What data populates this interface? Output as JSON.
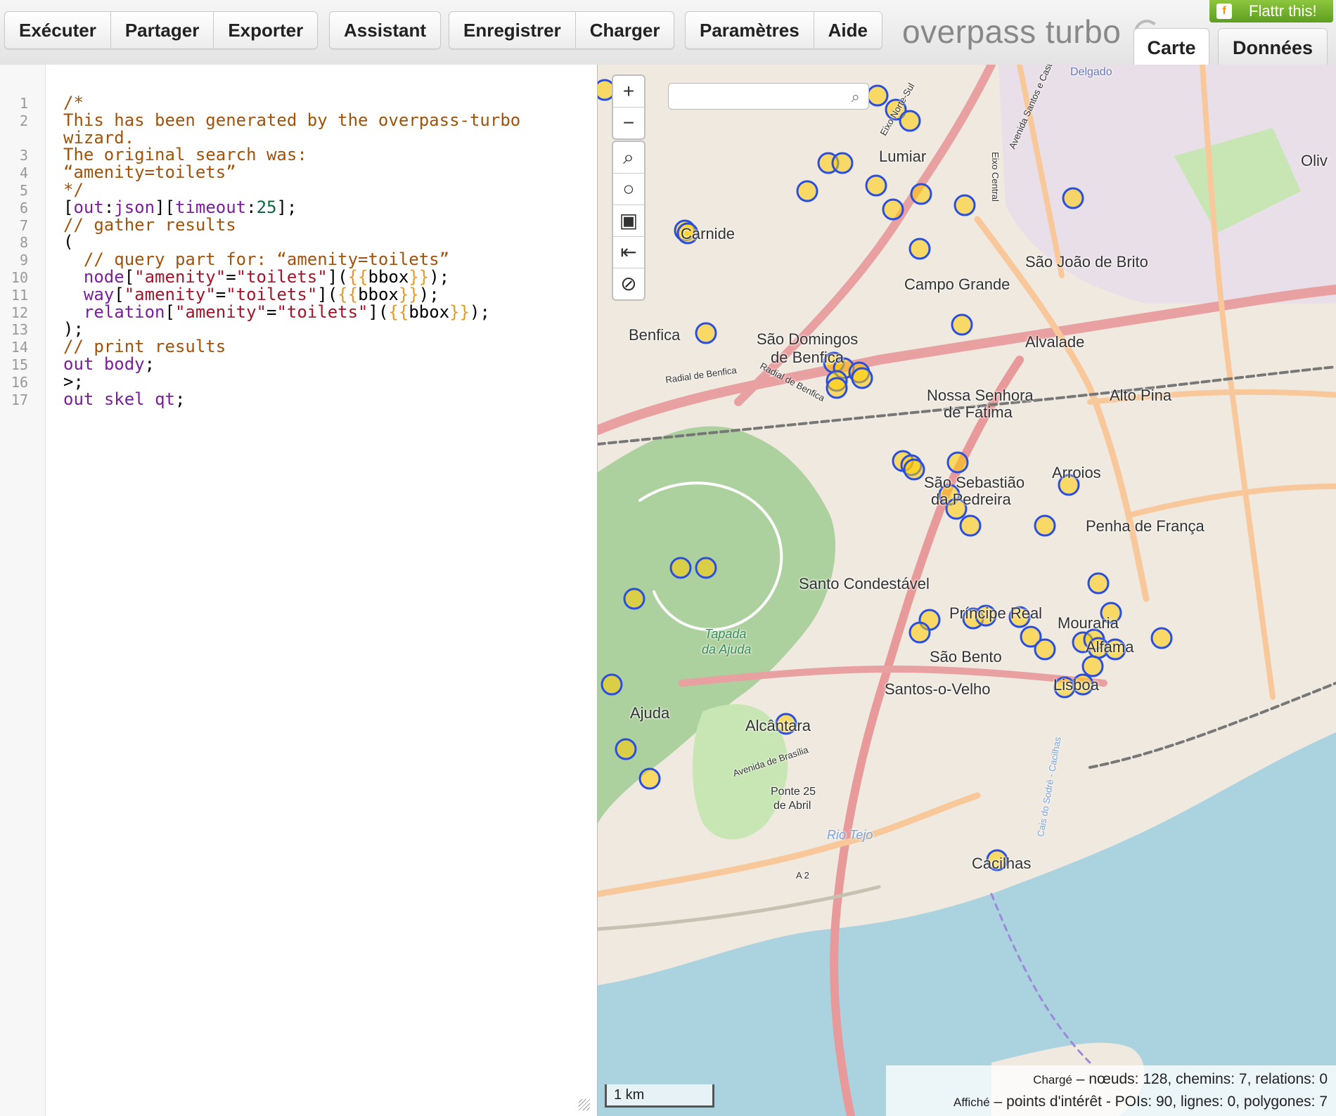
{
  "toolbar": {
    "group1": [
      "Exécuter",
      "Partager",
      "Exporter"
    ],
    "group2": [
      "Assistant"
    ],
    "group3": [
      "Enregistrer",
      "Charger"
    ],
    "group4": [
      "Paramètres",
      "Aide"
    ]
  },
  "brand": "overpass turbo",
  "flattr": "Flattr this!",
  "tabs": {
    "map": "Carte",
    "data": "Données"
  },
  "editor": {
    "lines": [
      "/*",
      "This has been generated by the overpass-turbo",
      "wizard.",
      "The original search was:",
      "“amenity=toilets”",
      "*/",
      "[out:json][timeout:25];",
      "// gather results",
      "(",
      "  // query part for: “amenity=toilets”",
      "  node[\"amenity\"=\"toilets\"]({{bbox}});",
      "  way[\"amenity\"=\"toilets\"]({{bbox}});",
      "  relation[\"amenity\"=\"toilets\"]({{bbox}});",
      ");",
      "// print results",
      "out body;",
      ">;",
      "out skel qt;"
    ],
    "line_numbers": [
      "1",
      "2",
      "",
      "3",
      "4",
      "5",
      "6",
      "7",
      "8",
      "9",
      "10",
      "11",
      "12",
      "13",
      "14",
      "15",
      "16",
      "17"
    ]
  },
  "map": {
    "zoom_in": "+",
    "zoom_out": "−",
    "scale": "1 km",
    "stats_loaded_label": "Chargé",
    "stats_loaded": "nœuds: 128, chemins: 7, relations: 0",
    "stats_shown_label": "Affiché",
    "stats_shown": "points d'intérêt - POIs: 90, lignes: 0, polygones: 7",
    "places": [
      "Lumiar",
      "Carnide",
      "Campo Grande",
      "São João de Brito",
      "Benfica",
      "São Domingos",
      "de Benfica",
      "Alvalade",
      "Nossa Senhora",
      "de Fátima",
      "Alto Pina",
      "Arroios",
      "São Sebastião",
      "da Pedreira",
      "Penha de França",
      "Santo Condestável",
      "Príncipe Real",
      "Mouraria",
      "Alfama",
      "São Bento",
      "Santos-o-Velho",
      "Lisboa",
      "Ajuda",
      "Alcântara",
      "Cacilhas",
      "Ponte 25",
      "de Abril",
      "Oliv",
      "Delgado"
    ],
    "park_labels": [
      "Tapada",
      "da Ajuda"
    ],
    "water_labels": [
      "Rio Tejo"
    ],
    "road_labels": [
      "Radial de Benfica",
      "Radial de Benfica",
      "Avenida de Brasília",
      "Eixo Central",
      "Avenida Santos e Castro",
      "Eixo Norte-Sul",
      "Cais do Sodré - Cacilhas",
      "A 2"
    ]
  }
}
